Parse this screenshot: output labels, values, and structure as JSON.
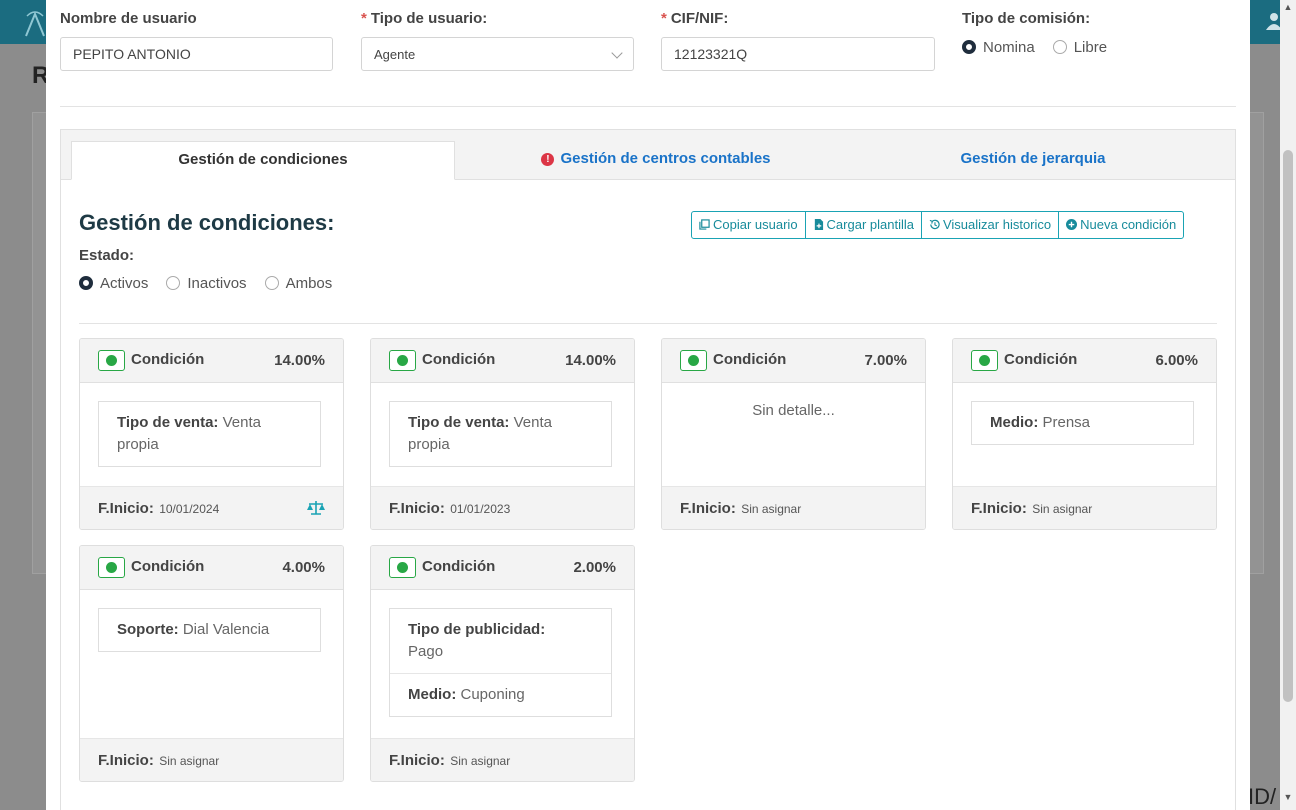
{
  "background": {
    "page_title_fragment": "R",
    "tail_text": "ID/"
  },
  "form": {
    "nombre": {
      "label": "Nombre de usuario",
      "value": "PEPITO ANTONIO"
    },
    "tipo_usuario": {
      "label": "Tipo de usuario:",
      "required_mark": "*",
      "value": "Agente"
    },
    "cif": {
      "label": "CIF/NIF:",
      "required_mark": "*",
      "value": "12123321Q"
    },
    "tipo_comision": {
      "label": "Tipo de comisión:",
      "options": [
        "Nomina",
        "Libre"
      ],
      "selected": "Nomina"
    }
  },
  "tabs": [
    {
      "label": "Gestión de condiciones",
      "active": true
    },
    {
      "label": "Gestión de centros contables",
      "active": false,
      "warning_icon": "exclamation-circle-icon"
    },
    {
      "label": "Gestión de jerarquia",
      "active": false
    }
  ],
  "section": {
    "title": "Gestión de condiciones:",
    "estado_label": "Estado:",
    "estado_options": [
      "Activos",
      "Inactivos",
      "Ambos"
    ],
    "estado_selected": "Activos"
  },
  "actions": {
    "copiar": "Copiar usuario",
    "cargar": "Cargar plantilla",
    "historico": "Visualizar historico",
    "nueva": "Nueva condición"
  },
  "cards": [
    {
      "title": "Condición",
      "percent": "14.00%",
      "details": [
        {
          "key": "Tipo de venta:",
          "value": "Venta propia"
        }
      ],
      "start_label": "F.Inicio:",
      "start_value": "10/01/2024",
      "has_scale_icon": true
    },
    {
      "title": "Condición",
      "percent": "14.00%",
      "details": [
        {
          "key": "Tipo de venta:",
          "value": "Venta propia"
        }
      ],
      "start_label": "F.Inicio:",
      "start_value": "01/01/2023"
    },
    {
      "title": "Condición",
      "percent": "7.00%",
      "empty_text": "Sin detalle...",
      "start_label": "F.Inicio:",
      "start_value": "Sin asignar"
    },
    {
      "title": "Condición",
      "percent": "6.00%",
      "details": [
        {
          "key": "Medio:",
          "value": "Prensa"
        }
      ],
      "start_label": "F.Inicio:",
      "start_value": "Sin asignar"
    },
    {
      "title": "Condición",
      "percent": "4.00%",
      "details": [
        {
          "key": "Soporte:",
          "value": "Dial Valencia"
        }
      ],
      "start_label": "F.Inicio:",
      "start_value": "Sin asignar"
    },
    {
      "title": "Condición",
      "percent": "2.00%",
      "details": [
        {
          "key": "Tipo de publicidad:",
          "value": "Pago"
        },
        {
          "key": "Medio:",
          "value": "Cuponing"
        }
      ],
      "start_label": "F.Inicio:",
      "start_value": "Sin asignar"
    }
  ],
  "colors": {
    "accent": "#178b9b",
    "link": "#1a73c8",
    "active_toggle": "#28a745",
    "warning": "#dc3545",
    "header_bar": "#1b6c80"
  }
}
